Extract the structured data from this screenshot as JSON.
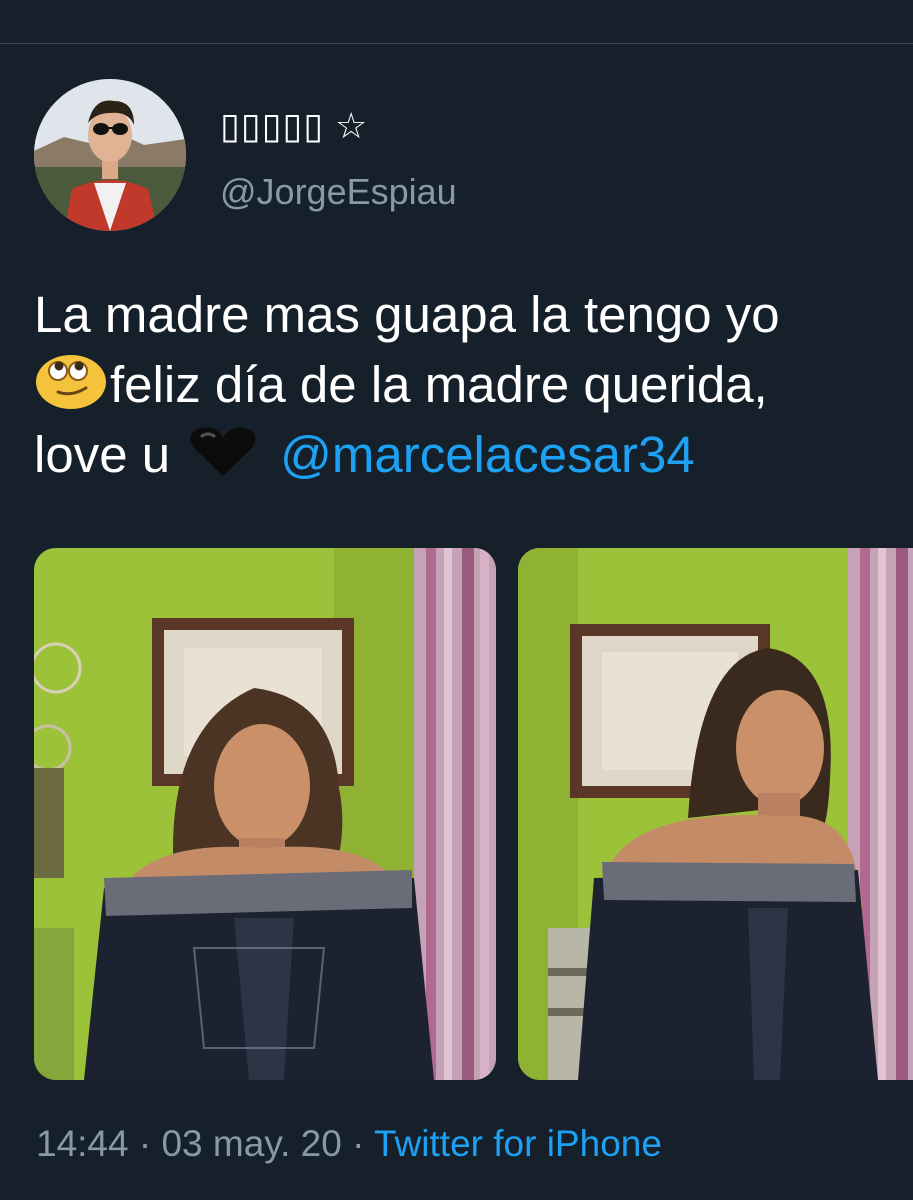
{
  "author": {
    "display_name": "▯▯▯▯▯ ☆",
    "handle": "@JorgeEspiau"
  },
  "tweet": {
    "line1": "La madre mas guapa la tengo yo",
    "line2": "feliz día de la madre querida,",
    "line3_text": "love u",
    "mention": "@marcelacesar34",
    "emoji_1": "face-with-rolling-eyes",
    "emoji_2": "black-heart"
  },
  "meta": {
    "time": "14:44",
    "separator": " · ",
    "date": "03 may. 20",
    "source": "Twitter for iPhone"
  },
  "colors": {
    "background": "#15202b",
    "link": "#1da1f2",
    "secondary_text": "#8899a6"
  }
}
